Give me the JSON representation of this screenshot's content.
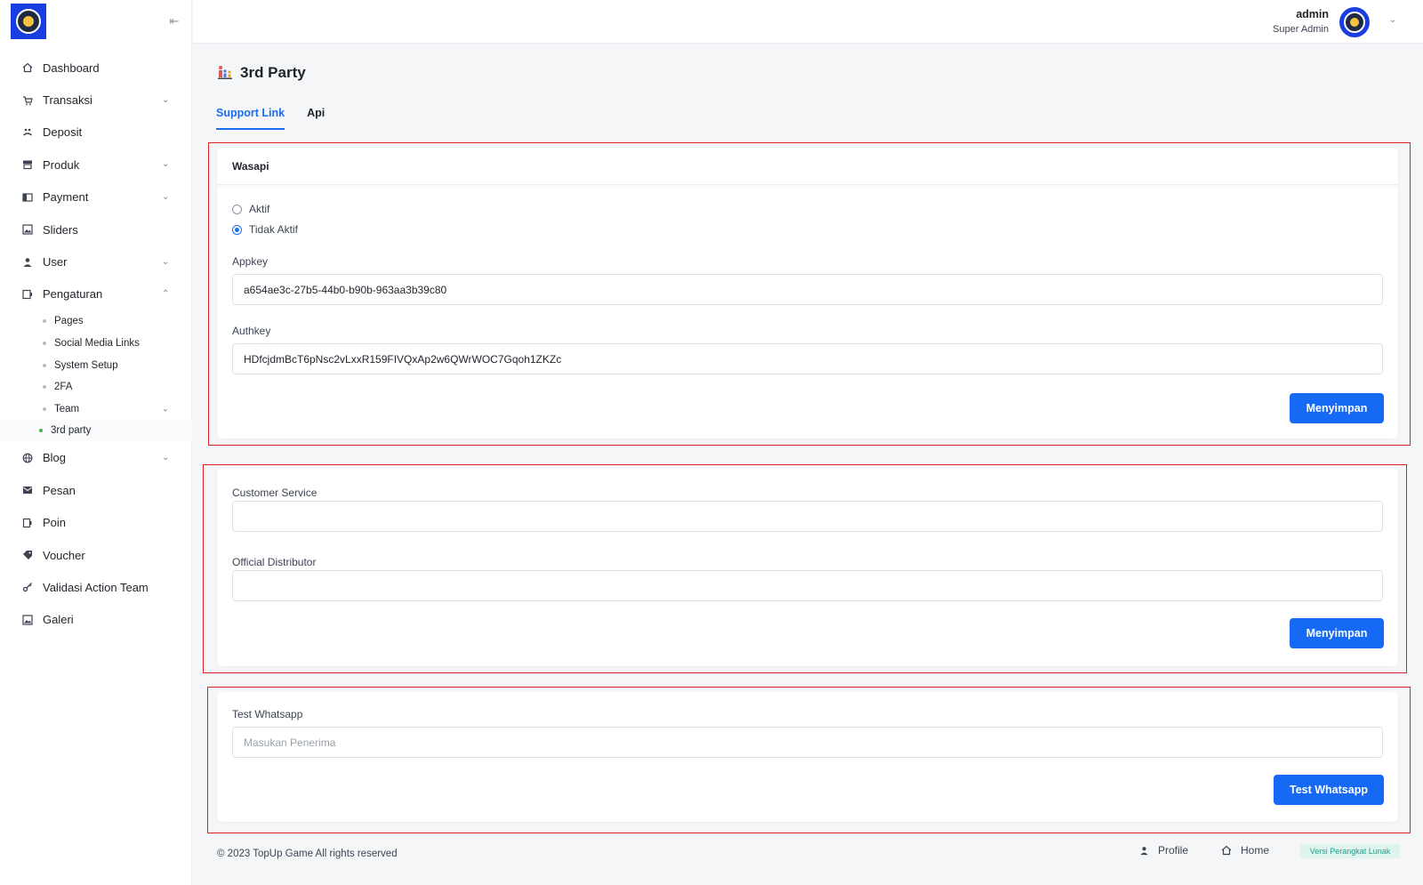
{
  "sidebar": {
    "items": [
      {
        "label": "Dashboard",
        "icon": "home-icon"
      },
      {
        "label": "Transaksi",
        "icon": "cart-icon"
      },
      {
        "label": "Deposit",
        "icon": "deposit-icon"
      },
      {
        "label": "Produk",
        "icon": "store-icon"
      },
      {
        "label": "Payment",
        "icon": "wallet-icon"
      },
      {
        "label": "Sliders",
        "icon": "image-icon"
      },
      {
        "label": "User",
        "icon": "user-icon"
      },
      {
        "label": "Pengaturan",
        "icon": "settings-icon"
      },
      {
        "label": "Blog",
        "icon": "globe-icon"
      },
      {
        "label": "Pesan",
        "icon": "mail-icon"
      },
      {
        "label": "Poin",
        "icon": "points-icon"
      },
      {
        "label": "Voucher",
        "icon": "tag-icon"
      },
      {
        "label": "Validasi Action Team",
        "icon": "key-icon"
      },
      {
        "label": "Galeri",
        "icon": "gallery-icon"
      }
    ],
    "sub_items": [
      {
        "label": "Pages"
      },
      {
        "label": "Social Media Links"
      },
      {
        "label": "System Setup"
      },
      {
        "label": "2FA"
      },
      {
        "label": "Team"
      },
      {
        "label": "3rd party"
      }
    ]
  },
  "header": {
    "user_name": "admin",
    "user_role": "Super Admin"
  },
  "page": {
    "title": "3rd Party",
    "tabs": [
      {
        "label": "Support Link"
      },
      {
        "label": "Api"
      }
    ]
  },
  "wasapi": {
    "title": "Wasapi",
    "radio_aktif": "Aktif",
    "radio_tidak_aktif": "Tidak Aktif",
    "appkey_label": "Appkey",
    "appkey_value": "a654ae3c-27b5-44b0-b90b-963aa3b39c80",
    "authkey_label": "Authkey",
    "authkey_value": "HDfcjdmBcT6pNsc2vLxxR159FIVQxAp2w6QWrWOC7Gqoh1ZKZc",
    "save_label": "Menyimpan"
  },
  "contacts": {
    "customer_service_label": "Customer Service",
    "customer_service_value": "",
    "official_distributor_label": "Official Distributor",
    "official_distributor_value": "",
    "save_label": "Menyimpan"
  },
  "test_whatsapp": {
    "label": "Test Whatsapp",
    "placeholder": "Masukan Penerima",
    "button_label": "Test Whatsapp"
  },
  "footer": {
    "copyright": "© 2023 TopUp Game All rights reserved",
    "profile_label": "Profile",
    "home_label": "Home",
    "version_label": "Versi Perangkat Lunak"
  },
  "colors": {
    "primary": "#1569f5",
    "highlight_outline": "#e21e26",
    "badge_bg": "#dff4ef",
    "badge_text": "#1da08a"
  }
}
